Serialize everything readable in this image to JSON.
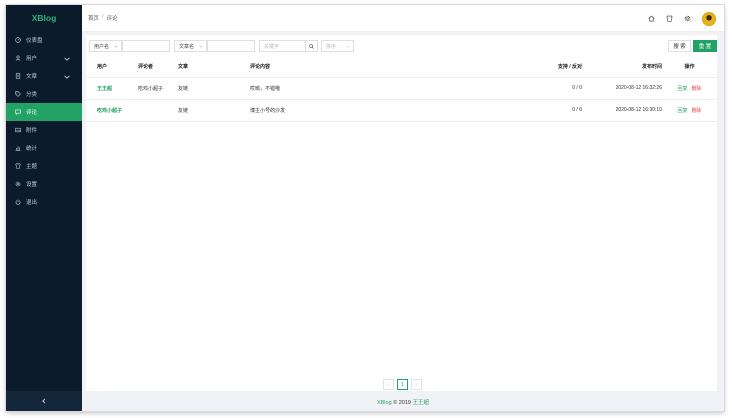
{
  "app": {
    "brand": "XBlog",
    "brand_color": "#2bb673",
    "accent": "#22a264",
    "danger": "#e2494a"
  },
  "sidebar": {
    "items": [
      {
        "label": "仪表盘",
        "icon": "dashboard-icon",
        "expandable": false,
        "active": false
      },
      {
        "label": "用户",
        "icon": "user-icon",
        "expandable": true,
        "active": false
      },
      {
        "label": "文章",
        "icon": "article-icon",
        "expandable": true,
        "active": false
      },
      {
        "label": "分类",
        "icon": "tag-icon",
        "expandable": false,
        "active": false
      },
      {
        "label": "评论",
        "icon": "comment-icon",
        "expandable": false,
        "active": true
      },
      {
        "label": "附件",
        "icon": "attachment-icon",
        "expandable": false,
        "active": false
      },
      {
        "label": "统计",
        "icon": "stats-icon",
        "expandable": false,
        "active": false
      },
      {
        "label": "主题",
        "icon": "theme-icon",
        "expandable": false,
        "active": false
      },
      {
        "label": "设置",
        "icon": "gear-icon",
        "expandable": false,
        "active": false
      },
      {
        "label": "退出",
        "icon": "power-icon",
        "expandable": false,
        "active": false
      }
    ],
    "collapse_icon": "chevron-left-icon"
  },
  "header": {
    "breadcrumb": [
      "首页",
      "评论"
    ],
    "breadcrumb_sep": "/",
    "icons": [
      "home-icon",
      "shirt-icon",
      "gear-icon"
    ]
  },
  "filters": {
    "field1_select": "用户名",
    "field1_value": "",
    "field2_select": "文章名",
    "field2_value": "",
    "keyword_placeholder": "关键字",
    "sort_select": "排序",
    "search_label": "搜 索",
    "reset_label": "重 置"
  },
  "table": {
    "columns": {
      "user": "用户",
      "commenter": "评论者",
      "article": "文章",
      "content": "评论内容",
      "votes": "支持 / 反对",
      "time": "发布时间",
      "ops": "操作"
    },
    "rows": [
      {
        "user": "王王超",
        "commenter": "吃鸡小超子",
        "article": "友链",
        "content": "哎呦，不错哦",
        "votes": "0 / 0",
        "time": "2020-08-12 16:32:26",
        "reply": "回复",
        "delete": "删除"
      },
      {
        "user": "吃鸡小超子",
        "commenter": "",
        "article": "友链",
        "content": "博主小号的沙发",
        "votes": "0 / 0",
        "time": "2020-08-12 16:30:10",
        "reply": "回复",
        "delete": "删除"
      }
    ]
  },
  "pagination": {
    "prev": "‹",
    "current": "1",
    "next": "›"
  },
  "footer": {
    "brand": "XBlog",
    "copyright": " © 2019 ",
    "owner": "王王超"
  }
}
